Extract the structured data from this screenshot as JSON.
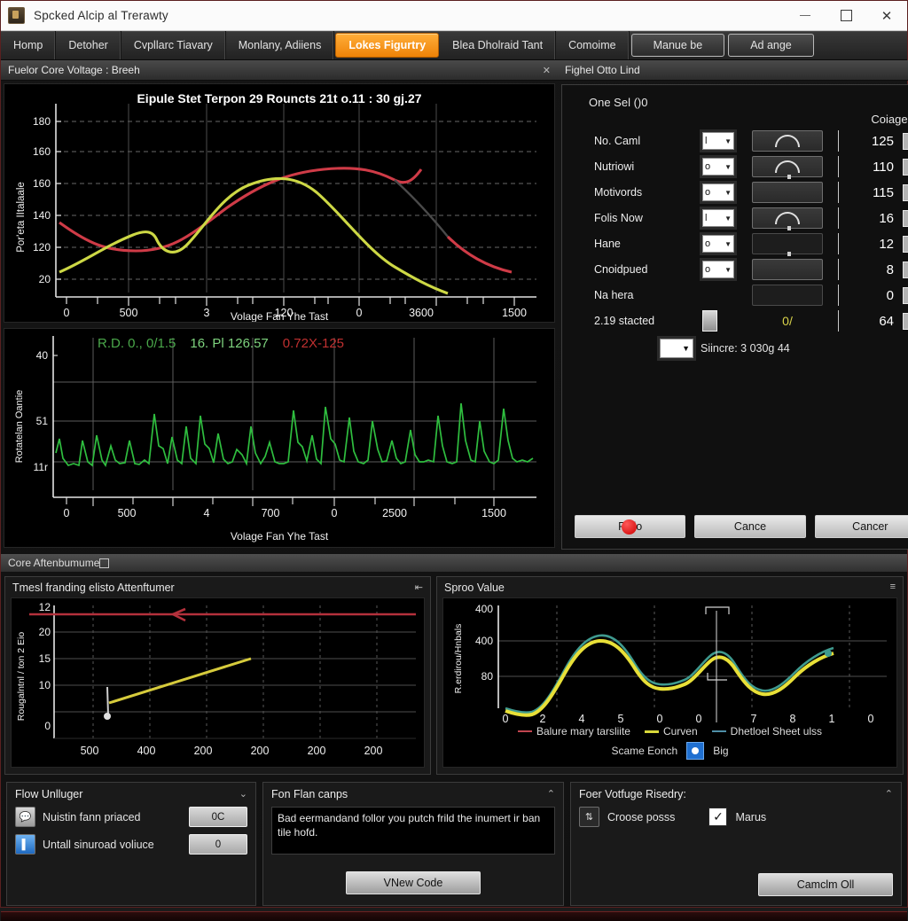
{
  "window": {
    "title": "Spcked Alcip al Trerawty",
    "icon": "app-icon",
    "minimize": "minimize-icon",
    "maximize": "maximize-icon",
    "close": "close-icon"
  },
  "tabs": [
    {
      "label": "Homp",
      "active": false,
      "style": "tab"
    },
    {
      "label": "Detoher",
      "active": false,
      "style": "tab"
    },
    {
      "label": "Cvpllarc Tiavary",
      "active": false,
      "style": "tab"
    },
    {
      "label": "Monlany, Adiiens",
      "active": false,
      "style": "tab"
    },
    {
      "label": "Lokes Figurtry",
      "active": true,
      "style": "tab"
    },
    {
      "label": "Blea Dholraid Tant",
      "active": false,
      "style": "tab"
    },
    {
      "label": "Comoime",
      "active": false,
      "style": "tab"
    },
    {
      "label": "Manue be",
      "active": false,
      "style": "button"
    },
    {
      "label": "Ad ange",
      "active": false,
      "style": "button"
    }
  ],
  "left_panel": {
    "header": "Fuelor Core Voltage : Breeh",
    "close": "close-icon"
  },
  "right_panel": {
    "header": "Fighel Otto Lind",
    "minimize": "minimize-icon",
    "subtitle": "One Sel ()0",
    "column_header": "Coiage",
    "rows": [
      {
        "label": "No. Caml",
        "select": "l",
        "control": "arc",
        "value": "125",
        "checked": true
      },
      {
        "label": "Nutriowi",
        "select": "o",
        "control": "arc",
        "value": "110",
        "checked": true
      },
      {
        "label": "Motivords",
        "select": "o",
        "control": "slider",
        "value": "115",
        "checked": true
      },
      {
        "label": "Folis Now",
        "select": "l",
        "control": "arc",
        "value": "16",
        "checked": true
      },
      {
        "label": "Hane",
        "select": "o",
        "control": "slider",
        "value": "12",
        "checked": true
      },
      {
        "label": "Cnoidpued",
        "select": "o",
        "control": "slider",
        "value": "8",
        "checked": true
      },
      {
        "label": "Na hera",
        "select": "",
        "control": "empty",
        "value": "0",
        "checked": true
      },
      {
        "label": "2.19 stacted",
        "select": "",
        "control": "ratio",
        "value": "64",
        "checked": true
      }
    ],
    "ratio_text": "0/",
    "since_select": "",
    "since_text": "Siincre: 3 030g 44",
    "buttons": [
      {
        "label": "Fiplo",
        "indicator": true
      },
      {
        "label": "Cance",
        "indicator": false
      },
      {
        "label": "Cancer",
        "indicator": false
      }
    ]
  },
  "lower_section": {
    "header": "Core Aftenbumume",
    "restore": "restore-icon",
    "left": {
      "caption": "Tmesl franding elisto Attenftumer",
      "menu": "menu-icon"
    },
    "right": {
      "caption": "Sproo Value",
      "menu": "menu-icon"
    }
  },
  "bottom_panels": [
    {
      "title": "Flow Unlluger",
      "collapse": "collapse-icon",
      "rows": [
        {
          "icon": "speech-bubble-icon",
          "label": "Nuistin fann priaced",
          "value": "0C"
        },
        {
          "icon": "file-icon",
          "label": "Untall sinuroad voliuce",
          "value": "0"
        }
      ]
    },
    {
      "title": "Fon Flan canps",
      "collapse": "collapse-icon",
      "log": "Bad eermandand follor you putch frild the inumert ir ban tile hofd.",
      "button": "VNew Code"
    },
    {
      "title": "Foer Votfuge Risedry:",
      "collapse": "collapse-icon",
      "spinner_label": "Croose posss",
      "spinner_icon": "updown-spinner-icon",
      "checkbox_label": "Marus",
      "checkbox_checked": true,
      "button": "Camclm Oll"
    }
  ],
  "chart_data": [
    {
      "id": "chart-main",
      "type": "line",
      "title": "Eipule Stet Terpon 29 Rouncts 21t o.11 : 30 gj.27",
      "xlabel": "Volage Fan Yhe Tast",
      "ylabel": "Por'eta IItalaale",
      "xticks": [
        "0",
        "500",
        "3",
        "120",
        "0",
        "3600",
        "1500"
      ],
      "yticks": [
        "180",
        "160",
        "160",
        "140",
        "120",
        "20"
      ],
      "ylim": [
        10,
        190
      ],
      "grid": true,
      "series": [
        {
          "name": "red-curve",
          "color": "#cf3b47",
          "values": [
            152,
            146,
            141,
            140,
            140,
            143,
            148,
            155,
            161,
            166,
            169,
            171,
            172,
            172,
            171,
            168,
            165,
            161,
            163,
            170
          ]
        },
        {
          "name": "yellow-curve",
          "color": "#cdd845",
          "values": [
            108,
            113,
            118,
            123,
            127,
            129,
            126,
            125,
            131,
            143,
            153,
            159,
            161,
            161,
            158,
            152,
            144,
            136,
            128,
            121
          ]
        }
      ]
    },
    {
      "id": "chart-signal",
      "type": "line",
      "title": "",
      "xlabel": "Volage Fan Yhe Tast",
      "ylabel": "Rotatelan Oantie",
      "xticks": [
        "0",
        "500",
        "4",
        "700",
        "0",
        "2500",
        "1500"
      ],
      "yticks": [
        "40",
        "51",
        "11r"
      ],
      "grid": true,
      "annotations": [
        {
          "text": "R.D. 0., 0/1.5",
          "color": "#4aa84a"
        },
        {
          "text": "16. Pl 126.57",
          "color": "#7ed37e"
        },
        {
          "text": "0.72X-125",
          "color": "#c03030"
        }
      ],
      "series": [
        {
          "name": "green-signal",
          "color": "#2fbe3f",
          "values": []
        }
      ]
    },
    {
      "id": "chart-trend",
      "type": "line",
      "title": "",
      "xlabel": "",
      "ylabel": "Rougalntnl / ton 2  Eio",
      "xticks": [
        "500",
        "400",
        "200",
        "200",
        "200",
        "200"
      ],
      "yticks": [
        "12",
        "20",
        "15",
        "10",
        "0"
      ],
      "grid": true,
      "series": [
        {
          "name": "red-threshold",
          "color": "#b4313c",
          "values": [
            23,
            23
          ]
        },
        {
          "name": "yellow-ramp",
          "color": "#d6cb3c",
          "values": [
            11.5,
            19
          ]
        }
      ]
    },
    {
      "id": "chart-spro",
      "type": "line",
      "title": "Sproo Value",
      "xlabel": "",
      "ylabel": "R.erdirou/Hnbals",
      "xticks": [
        "0",
        "2",
        "4",
        "5",
        "0",
        "0",
        "7",
        "8",
        "1",
        "0"
      ],
      "yticks": [
        "400",
        "400",
        "80"
      ],
      "grid": true,
      "legend": [
        {
          "label": "Balure mary tarsliite",
          "color": "#c0454f"
        },
        {
          "label": "Curven",
          "color": "#d8d83a"
        },
        {
          "label": "Dhetloel  Sheet ulss",
          "color": "#4e8fa8"
        }
      ],
      "footer_label": "Scame  Eonch",
      "footer_radio": "Big",
      "series": [
        {
          "name": "Curven",
          "color": "#e8e038",
          "values": [
            84,
            80,
            79,
            82,
            95,
            120,
            146,
            161,
            163,
            155,
            132,
            112,
            105,
            104,
            107,
            120,
            133,
            128,
            112,
            103,
            100,
            107,
            120,
            130,
            136
          ]
        },
        {
          "name": "Dhetloel",
          "color": "#3f9a8f",
          "values": [
            84,
            80,
            79,
            82,
            96,
            122,
            149,
            165,
            167,
            158,
            134,
            114,
            109,
            109,
            112,
            125,
            138,
            132,
            115,
            105,
            102,
            110,
            124,
            134,
            140
          ]
        }
      ]
    }
  ]
}
